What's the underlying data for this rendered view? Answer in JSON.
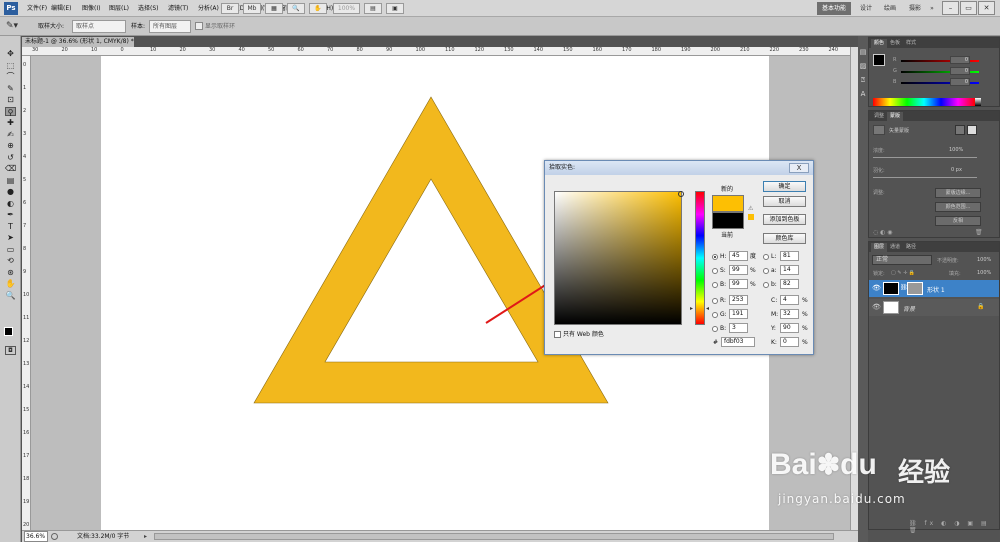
{
  "app": {
    "logo": "Ps"
  },
  "menu": {
    "items": [
      "文件(F)",
      "编辑(E)",
      "图像(I)",
      "图层(L)",
      "选择(S)",
      "滤镜(T)",
      "分析(A)",
      "3D(D)",
      "视图(V)",
      "窗口(W)",
      "帮助(H)"
    ]
  },
  "menubar_controls": {
    "zoom": "100%"
  },
  "workspace": {
    "active": "基本功能",
    "items": [
      "基本功能",
      "设计",
      "绘画",
      "摄影"
    ],
    "more": "»"
  },
  "options": {
    "sample_size_label": "取样大小:",
    "sample_size_value": "取样点",
    "sample_label": "样本:",
    "sample_value": "所有图层",
    "show_ring_label": "显示取样环"
  },
  "document": {
    "tab_title": "未标题-1 @ 36.6% (形状 1, CMYK/8) *",
    "zoom": "36.6%",
    "doc_info": "文档:33.2M/0 字节"
  },
  "ruler": {
    "top_ticks": [
      "30",
      "20",
      "10",
      "0",
      "10",
      "20",
      "30",
      "40",
      "50",
      "60",
      "70",
      "80",
      "90",
      "100",
      "110",
      "120",
      "130",
      "140",
      "150",
      "160",
      "170",
      "180",
      "190",
      "200",
      "210",
      "220",
      "230",
      "240"
    ],
    "left_ticks": [
      "0",
      "1",
      "2",
      "3",
      "4",
      "5",
      "6",
      "7",
      "8",
      "9",
      "10",
      "11",
      "12",
      "13",
      "14",
      "15",
      "16",
      "17",
      "18",
      "19",
      "20"
    ]
  },
  "shape": {
    "fill": "#f2b81d",
    "stroke": "#8a6a10"
  },
  "color_picker": {
    "title": "拾取实色:",
    "close": "X",
    "ok_label": "确定",
    "cancel_label": "取消",
    "add_swatch_label": "添加到色板",
    "libraries_label": "颜色库",
    "new_label": "新的",
    "current_label": "当前",
    "new_color": "#fdbf03",
    "current_color": "#000000",
    "web_only_label": "只有 Web 颜色",
    "fields": {
      "H": {
        "label": "H:",
        "value": "45",
        "unit": "度"
      },
      "S": {
        "label": "S:",
        "value": "99",
        "unit": "%"
      },
      "B": {
        "label": "B:",
        "value": "99",
        "unit": "%"
      },
      "R": {
        "label": "R:",
        "value": "253"
      },
      "G": {
        "label": "G:",
        "value": "191"
      },
      "Bc": {
        "label": "B:",
        "value": "3"
      },
      "L": {
        "label": "L:",
        "value": "81"
      },
      "a": {
        "label": "a:",
        "value": "14"
      },
      "b": {
        "label": "b:",
        "value": "82"
      },
      "C": {
        "label": "C:",
        "value": "4",
        "unit": "%"
      },
      "M": {
        "label": "M:",
        "value": "32",
        "unit": "%"
      },
      "Y": {
        "label": "Y:",
        "value": "90",
        "unit": "%"
      },
      "K": {
        "label": "K:",
        "value": "0",
        "unit": "%"
      }
    },
    "hex_label": "#",
    "hex": "fdbf03"
  },
  "color_panel": {
    "tabs": [
      "颜色",
      "色板",
      "样式"
    ],
    "r": "0",
    "g": "0",
    "b": "0"
  },
  "adjust_panel": {
    "tabs": [
      "调整",
      "蒙版"
    ],
    "mode": "矢量蒙版",
    "density_label": "浓度:",
    "density_value": "100%",
    "feather_label": "羽化:",
    "feather_value": "0 px",
    "refine_label": "调整:",
    "mask_edge": "蒙版边缘...",
    "color_range": "颜色范围...",
    "invert": "反相"
  },
  "layers_panel": {
    "tabs": [
      "图层",
      "通道",
      "路径"
    ],
    "blend_mode": "正常",
    "opacity_label": "不透明度:",
    "opacity_value": "100%",
    "lock_label": "锁定:",
    "fill_label": "填充:",
    "fill_value": "100%",
    "layers": [
      {
        "name": "形状 1",
        "selected": true
      },
      {
        "name": "背景",
        "selected": false
      }
    ]
  },
  "watermark": {
    "brand_left": "Bai",
    "brand_right": "du",
    "brand_cn": "经验",
    "url": "jingyan.baidu.com"
  }
}
